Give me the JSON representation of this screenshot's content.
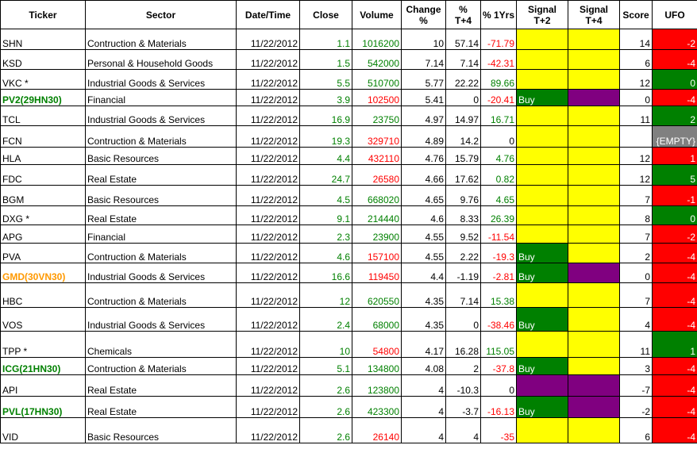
{
  "headers": {
    "ticker": "Ticker",
    "sector": "Sector",
    "datetime": "Date/Time",
    "close": "Close",
    "volume": "Volume",
    "change_l1": "Change",
    "change_l2": "%",
    "t4_l1": "%",
    "t4_l2": "T+4",
    "yrs": "% 1Yrs",
    "sig2_l1": "Signal",
    "sig2_l2": "T+2",
    "sig4_l1": "Signal",
    "sig4_l2": "T+4",
    "score": "Score",
    "ufo": "UFO"
  },
  "colors": {
    "yellow": "#ffff00",
    "green": "#008000",
    "purple": "#800080",
    "red": "#ff0000",
    "gray": "#808080"
  },
  "rows": [
    {
      "ticker": "SHN",
      "ticker_style": "plain",
      "sector": "Contruction & Materials",
      "datetime": "11/22/2012",
      "close": "1.1",
      "close_color": "pos",
      "volume": "1016200",
      "volume_color": "pos",
      "change": "10",
      "t4": "57.14",
      "t4_color": "blk",
      "yrs": "-71.79",
      "yrs_color": "neg",
      "sig2": "",
      "sig2_bg": "yellow",
      "sig4": "",
      "sig4_bg": "yellow",
      "score": "14",
      "ufo": "-2",
      "ufo_bg": "red"
    },
    {
      "ticker": "KSD",
      "ticker_style": "plain",
      "sector": "Personal & Household Goods",
      "datetime": "11/22/2012",
      "close": "1.5",
      "close_color": "pos",
      "volume": "542000",
      "volume_color": "pos",
      "change": "7.14",
      "t4": "7.14",
      "t4_color": "blk",
      "yrs": "-42.31",
      "yrs_color": "neg",
      "sig2": "",
      "sig2_bg": "yellow",
      "sig4": "",
      "sig4_bg": "yellow",
      "score": "6",
      "ufo": "-4",
      "ufo_bg": "red"
    },
    {
      "ticker": "VKC *",
      "ticker_style": "plain",
      "sector": "Industrial Goods & Services",
      "datetime": "11/22/2012",
      "close": "5.5",
      "close_color": "pos",
      "volume": "510700",
      "volume_color": "pos",
      "change": "5.77",
      "t4": "22.22",
      "t4_color": "blk",
      "yrs": "89.66",
      "yrs_color": "pos",
      "sig2": "",
      "sig2_bg": "yellow",
      "sig4": "",
      "sig4_bg": "yellow",
      "score": "12",
      "ufo": "0",
      "ufo_bg": "green"
    },
    {
      "ticker": "PV2(29HN30)",
      "ticker_style": "green",
      "sector": "Financial",
      "datetime": "11/22/2012",
      "close": "3.9",
      "close_color": "pos",
      "volume": "102500",
      "volume_color": "neg",
      "change": "5.41",
      "t4": "0",
      "t4_color": "blk",
      "yrs": "-20.41",
      "yrs_color": "neg",
      "sig2": "Buy",
      "sig2_bg": "green",
      "sig4": "",
      "sig4_bg": "purple",
      "score": "0",
      "ufo": "-4",
      "ufo_bg": "red"
    },
    {
      "ticker": "TCL",
      "ticker_style": "plain",
      "sector": "Industrial Goods & Services",
      "datetime": "11/22/2012",
      "close": "16.9",
      "close_color": "pos",
      "volume": "23750",
      "volume_color": "pos",
      "change": "4.97",
      "t4": "14.97",
      "t4_color": "blk",
      "yrs": "16.71",
      "yrs_color": "pos",
      "sig2": "",
      "sig2_bg": "yellow",
      "sig4": "",
      "sig4_bg": "yellow",
      "score": "11",
      "ufo": "2",
      "ufo_bg": "green"
    },
    {
      "ticker": "FCN",
      "ticker_style": "plain",
      "sector": "Contruction & Materials",
      "datetime": "11/22/2012",
      "close": "19.3",
      "close_color": "pos",
      "volume": "329710",
      "volume_color": "neg",
      "change": "4.89",
      "t4": "14.2",
      "t4_color": "blk",
      "yrs": "0",
      "yrs_color": "blk",
      "sig2": "",
      "sig2_bg": "yellow",
      "sig4": "",
      "sig4_bg": "yellow",
      "score": "",
      "ufo": "{EMPTY}",
      "ufo_bg": "gray"
    },
    {
      "ticker": "HLA",
      "ticker_style": "plain",
      "sector": "Basic Resources",
      "datetime": "11/22/2012",
      "close": "4.4",
      "close_color": "pos",
      "volume": "432110",
      "volume_color": "neg",
      "change": "4.76",
      "t4": "15.79",
      "t4_color": "blk",
      "yrs": "4.76",
      "yrs_color": "pos",
      "sig2": "",
      "sig2_bg": "yellow",
      "sig4": "",
      "sig4_bg": "yellow",
      "score": "12",
      "ufo": "1",
      "ufo_bg": "red"
    },
    {
      "ticker": "FDC",
      "ticker_style": "plain",
      "sector": "Real Estate",
      "datetime": "11/22/2012",
      "close": "24.7",
      "close_color": "pos",
      "volume": "26580",
      "volume_color": "neg",
      "change": "4.66",
      "t4": "17.62",
      "t4_color": "blk",
      "yrs": "0.82",
      "yrs_color": "pos",
      "sig2": "",
      "sig2_bg": "yellow",
      "sig4": "",
      "sig4_bg": "yellow",
      "score": "12",
      "ufo": "5",
      "ufo_bg": "green"
    },
    {
      "ticker": "BGM",
      "ticker_style": "plain",
      "sector": "Basic Resources",
      "datetime": "11/22/2012",
      "close": "4.5",
      "close_color": "pos",
      "volume": "668020",
      "volume_color": "pos",
      "change": "4.65",
      "t4": "9.76",
      "t4_color": "blk",
      "yrs": "4.65",
      "yrs_color": "pos",
      "sig2": "",
      "sig2_bg": "yellow",
      "sig4": "",
      "sig4_bg": "yellow",
      "score": "7",
      "ufo": "-1",
      "ufo_bg": "red"
    },
    {
      "ticker": "DXG *",
      "ticker_style": "plain",
      "sector": "Real Estate",
      "datetime": "11/22/2012",
      "close": "9.1",
      "close_color": "pos",
      "volume": "214440",
      "volume_color": "pos",
      "change": "4.6",
      "t4": "8.33",
      "t4_color": "blk",
      "yrs": "26.39",
      "yrs_color": "pos",
      "sig2": "",
      "sig2_bg": "yellow",
      "sig4": "",
      "sig4_bg": "yellow",
      "score": "8",
      "ufo": "0",
      "ufo_bg": "green"
    },
    {
      "ticker": "APG",
      "ticker_style": "plain",
      "sector": "Financial",
      "datetime": "11/22/2012",
      "close": "2.3",
      "close_color": "pos",
      "volume": "23900",
      "volume_color": "pos",
      "change": "4.55",
      "t4": "9.52",
      "t4_color": "blk",
      "yrs": "-11.54",
      "yrs_color": "neg",
      "sig2": "",
      "sig2_bg": "yellow",
      "sig4": "",
      "sig4_bg": "yellow",
      "score": "7",
      "ufo": "-2",
      "ufo_bg": "red"
    },
    {
      "ticker": "PVA",
      "ticker_style": "plain",
      "sector": "Contruction & Materials",
      "datetime": "11/22/2012",
      "close": "4.6",
      "close_color": "pos",
      "volume": "157100",
      "volume_color": "neg",
      "change": "4.55",
      "t4": "2.22",
      "t4_color": "blk",
      "yrs": "-19.3",
      "yrs_color": "neg",
      "sig2": "Buy",
      "sig2_bg": "green",
      "sig4": "",
      "sig4_bg": "yellow",
      "score": "2",
      "ufo": "-4",
      "ufo_bg": "red"
    },
    {
      "ticker": "GMD(30VN30)",
      "ticker_style": "orange",
      "sector": "Industrial Goods & Services",
      "datetime": "11/22/2012",
      "close": "16.6",
      "close_color": "pos",
      "volume": "119450",
      "volume_color": "neg",
      "change": "4.4",
      "t4": "-1.19",
      "t4_color": "blk",
      "yrs": "-2.81",
      "yrs_color": "neg",
      "sig2": "Buy",
      "sig2_bg": "green",
      "sig4": "",
      "sig4_bg": "purple",
      "score": "0",
      "ufo": "-4",
      "ufo_bg": "red"
    },
    {
      "ticker": "HBC",
      "ticker_style": "plain",
      "sector": "Contruction & Materials",
      "datetime": "11/22/2012",
      "close": "12",
      "close_color": "pos",
      "volume": "620550",
      "volume_color": "pos",
      "change": "4.35",
      "t4": "7.14",
      "t4_color": "blk",
      "yrs": "15.38",
      "yrs_color": "pos",
      "sig2": "",
      "sig2_bg": "yellow",
      "sig4": "",
      "sig4_bg": "yellow",
      "score": "7",
      "ufo": "-4",
      "ufo_bg": "red"
    },
    {
      "ticker": "VOS",
      "ticker_style": "plain",
      "sector": "Industrial Goods & Services",
      "datetime": "11/22/2012",
      "close": "2.4",
      "close_color": "pos",
      "volume": "68000",
      "volume_color": "pos",
      "change": "4.35",
      "t4": "0",
      "t4_color": "blk",
      "yrs": "-38.46",
      "yrs_color": "neg",
      "sig2": "Buy",
      "sig2_bg": "green",
      "sig4": "",
      "sig4_bg": "yellow",
      "score": "4",
      "ufo": "-4",
      "ufo_bg": "red"
    },
    {
      "ticker": "TPP *",
      "ticker_style": "plain",
      "sector": "Chemicals",
      "datetime": "11/22/2012",
      "close": "10",
      "close_color": "pos",
      "volume": "54800",
      "volume_color": "neg",
      "change": "4.17",
      "t4": "16.28",
      "t4_color": "blk",
      "yrs": "115.05",
      "yrs_color": "pos",
      "sig2": "",
      "sig2_bg": "yellow",
      "sig4": "",
      "sig4_bg": "yellow",
      "score": "11",
      "ufo": "1",
      "ufo_bg": "green"
    },
    {
      "ticker": "ICG(21HN30)",
      "ticker_style": "green",
      "sector": "Contruction & Materials",
      "datetime": "11/22/2012",
      "close": "5.1",
      "close_color": "pos",
      "volume": "134800",
      "volume_color": "pos",
      "change": "4.08",
      "t4": "2",
      "t4_color": "blk",
      "yrs": "-37.8",
      "yrs_color": "neg",
      "sig2": "Buy",
      "sig2_bg": "green",
      "sig4": "",
      "sig4_bg": "yellow",
      "score": "3",
      "ufo": "-4",
      "ufo_bg": "red"
    },
    {
      "ticker": "API",
      "ticker_style": "plain",
      "sector": "Real Estate",
      "datetime": "11/22/2012",
      "close": "2.6",
      "close_color": "pos",
      "volume": "123800",
      "volume_color": "pos",
      "change": "4",
      "t4": "-10.3",
      "t4_color": "blk",
      "yrs": "0",
      "yrs_color": "blk",
      "sig2": "",
      "sig2_bg": "purple",
      "sig4": "",
      "sig4_bg": "purple",
      "score": "-7",
      "ufo": "-4",
      "ufo_bg": "red"
    },
    {
      "ticker": "PVL(17HN30)",
      "ticker_style": "green",
      "sector": "Real Estate",
      "datetime": "11/22/2012",
      "close": "2.6",
      "close_color": "pos",
      "volume": "423300",
      "volume_color": "pos",
      "change": "4",
      "t4": "-3.7",
      "t4_color": "blk",
      "yrs": "-16.13",
      "yrs_color": "neg",
      "sig2": "Buy",
      "sig2_bg": "green",
      "sig4": "",
      "sig4_bg": "purple",
      "score": "-2",
      "ufo": "-4",
      "ufo_bg": "red"
    },
    {
      "ticker": "VID",
      "ticker_style": "plain",
      "sector": "Basic Resources",
      "datetime": "11/22/2012",
      "close": "2.6",
      "close_color": "pos",
      "volume": "26140",
      "volume_color": "neg",
      "change": "4",
      "t4": "4",
      "t4_color": "blk",
      "yrs": "-35",
      "yrs_color": "neg",
      "sig2": "",
      "sig2_bg": "yellow",
      "sig4": "",
      "sig4_bg": "yellow",
      "score": "6",
      "ufo": "-4",
      "ufo_bg": "red"
    }
  ]
}
